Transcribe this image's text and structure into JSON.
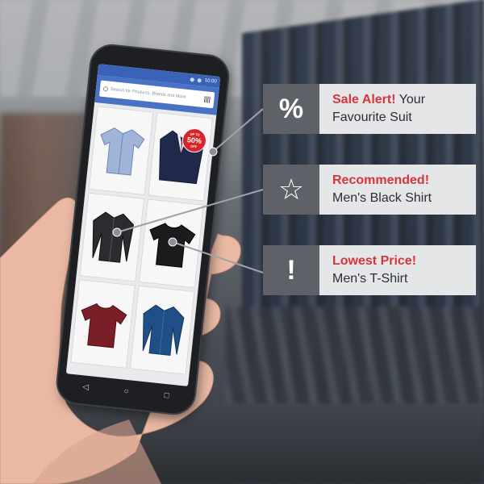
{
  "phone": {
    "status_time": "10:00",
    "search_placeholder": "Search for Products, Brands and More",
    "sale_badge": {
      "up_to": "UP TO",
      "percent": "50%",
      "off": "OFF"
    },
    "products": [
      {
        "name": "Men's Checked Shirt",
        "icon": "shirt-icon",
        "color": "#9fb4d8"
      },
      {
        "name": "Men's Suit",
        "icon": "suit-icon",
        "color": "#1f2a4a"
      },
      {
        "name": "Men's Black Shirt",
        "icon": "shirt-icon",
        "color": "#2a2c30"
      },
      {
        "name": "Men's T-Shirt",
        "icon": "tshirt-icon",
        "color": "#1c1c1e"
      },
      {
        "name": "Maroon T-Shirt",
        "icon": "tshirt-icon",
        "color": "#7a1f27"
      },
      {
        "name": "Blue Shirt",
        "icon": "shirt-icon",
        "color": "#1f4f86"
      }
    ],
    "nav": {
      "back": "◁",
      "home": "○",
      "recent": "□"
    }
  },
  "callouts": [
    {
      "icon": "percent-icon",
      "icon_glyph": "%",
      "highlight": "Sale Alert!",
      "rest": " Your",
      "line2": "Favourite Suit"
    },
    {
      "icon": "star-icon",
      "icon_glyph": "☆",
      "highlight": "Recommended!",
      "rest": "",
      "line2": "Men's Black Shirt"
    },
    {
      "icon": "exclamation-icon",
      "icon_glyph": "!",
      "highlight": "Lowest Price!",
      "rest": "",
      "line2": "Men's T-Shirt"
    }
  ],
  "colors": {
    "accent": "#d6353d",
    "icon_box": "#5e6167",
    "text_box": "#e5e6e8",
    "app_bar": "#4a72c4"
  }
}
